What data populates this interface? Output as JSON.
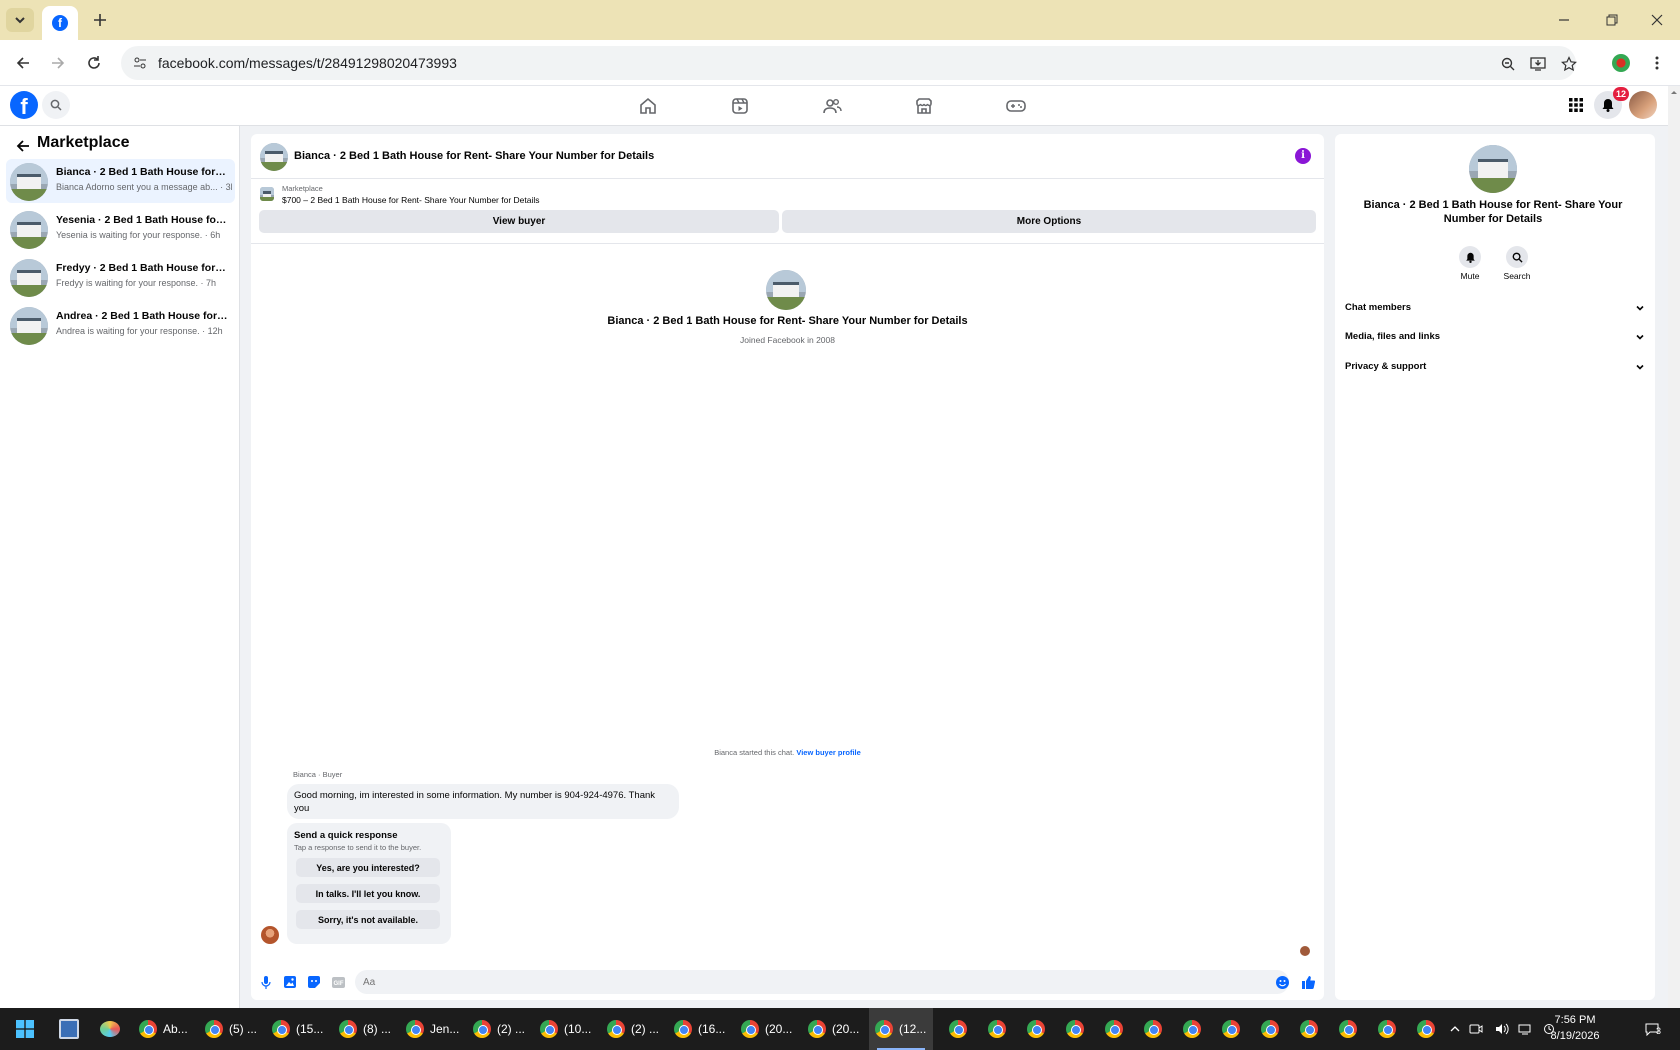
{
  "browser": {
    "url": "facebook.com/messages/t/28491298020473993",
    "tab_favicon": "facebook-icon"
  },
  "fb_header": {
    "notifications_count": "12",
    "nav_icons": [
      "home-icon",
      "reels-icon",
      "friends-icon",
      "marketplace-icon",
      "gaming-icon"
    ]
  },
  "sidebar": {
    "title": "Marketplace",
    "conversations": [
      {
        "name": "Bianca · 2 Bed 1 Bath House for Re...",
        "snippet": "Bianca Adorno sent you a message ab... · 3h"
      },
      {
        "name": "Yesenia · 2 Bed 1 Bath House for R...",
        "snippet": "Yesenia is waiting for your response. · 6h"
      },
      {
        "name": "Fredyy · 2 Bed 1 Bath House for Re...",
        "snippet": "Fredyy is waiting for your response. · 7h"
      },
      {
        "name": "Andrea · 2 Bed 1 Bath House for R...",
        "snippet": "Andrea is waiting for your response. · 12h"
      }
    ]
  },
  "chat": {
    "title": "Bianca · 2 Bed 1 Bath House for Rent- Share Your Number for Details",
    "marketplace_label": "Marketplace",
    "listing": "$700 – 2 Bed 1 Bath House for Rent- Share Your Number for Details",
    "view_buyer": "View buyer",
    "more_options": "More Options",
    "intro_name": "Bianca · 2 Bed 1 Bath House for Rent- Share Your Number for Details",
    "joined": "Joined Facebook in 2008",
    "started_text": "Bianca started this chat.",
    "view_buyer_profile": "View buyer profile",
    "sender": "Bianca · Buyer",
    "message": "Good morning, im interested in some information. My number is 904-924-4976. Thank you",
    "quick_title": "Send a quick response",
    "quick_sub": "Tap a response to send it to the buyer.",
    "quick_replies": [
      "Yes, are you interested?",
      "In talks. I'll let you know.",
      "Sorry, it's not available."
    ],
    "input_placeholder": "Aa"
  },
  "rpanel": {
    "name": "Bianca · 2 Bed 1 Bath House for Rent- Share Your Number for Details",
    "mute": "Mute",
    "search": "Search",
    "sections": [
      "Chat members",
      "Media, files and links",
      "Privacy & support"
    ]
  },
  "taskbar": {
    "items": [
      "Ab...",
      "(5) ...",
      "(15...",
      "(8) ...",
      "Jen...",
      "(2) ...",
      "(10...",
      "(2) ...",
      "(16...",
      "(20...",
      "(20...",
      "(12..."
    ],
    "time": "7:56 PM",
    "date": "8/19/2026",
    "notif_count": "3"
  }
}
